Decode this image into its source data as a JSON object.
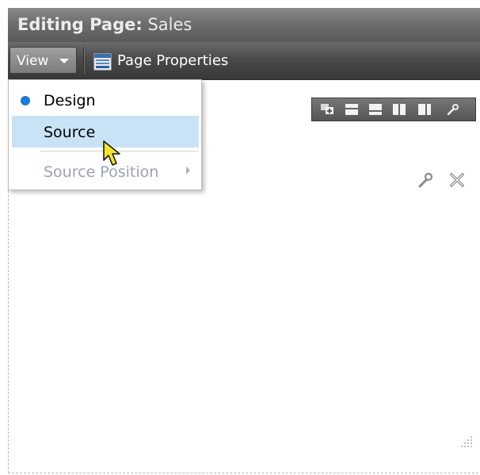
{
  "header": {
    "title_bold": "Editing Page:",
    "title_rest": " Sales"
  },
  "toolbar": {
    "view_label": "View",
    "view_caret_icon": "chevron-down-icon",
    "page_properties_label": "Page Properties",
    "page_properties_icon": "page-properties-icon"
  },
  "view_menu": {
    "items": [
      {
        "label": "Design",
        "selected": true,
        "icon": "radio-dot-icon"
      },
      {
        "label": "Source",
        "hovered": true
      },
      {
        "label": "Source Position",
        "disabled": true,
        "has_submenu": true,
        "icon": "chevron-right-icon"
      }
    ]
  },
  "component_toolbar": {
    "icons": [
      "add-content-icon",
      "layout-top-icon",
      "layout-bottom-icon",
      "layout-columns-icon",
      "layout-right-icon",
      "wrench-icon"
    ]
  },
  "region_actions": {
    "icons": [
      "wrench-icon",
      "close-icon"
    ]
  },
  "colors": {
    "header_gray": "#6e6e6e",
    "toolbar_dark": "#4a4a4a",
    "menu_highlight": "#c9e3f6",
    "selected_dot": "#1a7bd6",
    "disabled_text": "#9aa4b0"
  }
}
